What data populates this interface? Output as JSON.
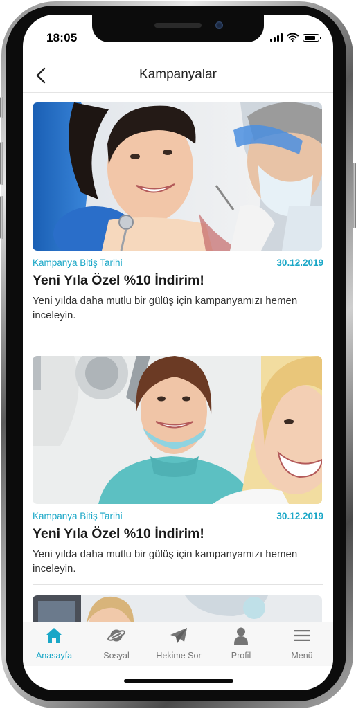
{
  "status_bar": {
    "time": "18:05",
    "battery_level": 0.85
  },
  "header": {
    "title": "Kampanyalar",
    "back_icon": "chevron-left-icon"
  },
  "campaigns": [
    {
      "end_label": "Kampanya Bitiş Tarihi",
      "end_date": "30.12.2019",
      "title": "Yeni Yıla Özel %10 İndirim!",
      "description": "Yeni yılda daha mutlu bir gülüş için kampanyamızı hemen inceleyin."
    },
    {
      "end_label": "Kampanya Bitiş Tarihi",
      "end_date": "30.12.2019",
      "title": "Yeni Yıla Özel %10 İndirim!",
      "description": "Yeni yılda daha mutlu bir gülüş için kampanyamızı hemen inceleyin."
    }
  ],
  "tabs": [
    {
      "label": "Anasayfa",
      "icon": "home-icon",
      "active": true
    },
    {
      "label": "Sosyal",
      "icon": "planet-icon",
      "active": false
    },
    {
      "label": "Hekime Sor",
      "icon": "paper-plane-icon",
      "active": false
    },
    {
      "label": "Profil",
      "icon": "person-icon",
      "active": false
    },
    {
      "label": "Menü",
      "icon": "hamburger-menu-icon",
      "active": false
    }
  ],
  "colors": {
    "accent": "#1aa7c7",
    "inactive_tab": "#777777",
    "title_text": "#1a1a1a"
  }
}
